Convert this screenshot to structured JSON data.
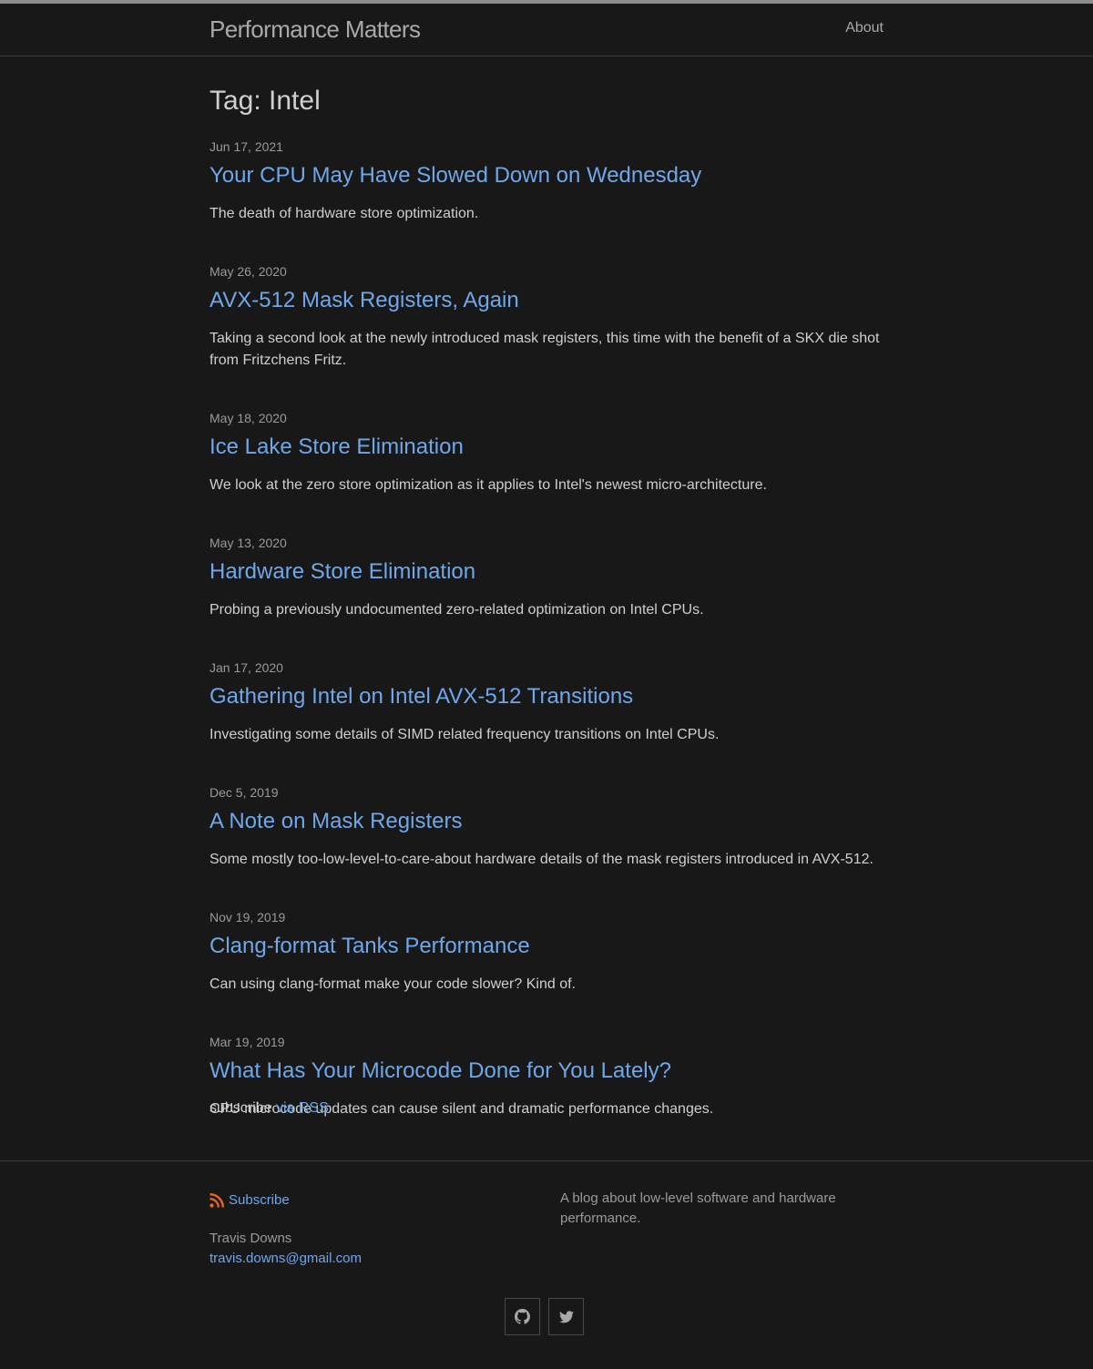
{
  "header": {
    "site_title": "Performance Matters",
    "nav": [
      {
        "label": "About"
      }
    ]
  },
  "page": {
    "heading": "Tag: Intel"
  },
  "posts": [
    {
      "date": "Jun 17, 2021",
      "title": "Your CPU May Have Slowed Down on Wednesday",
      "excerpt": "The death of hardware store optimization."
    },
    {
      "date": "May 26, 2020",
      "title": "AVX-512 Mask Registers, Again",
      "excerpt": "Taking a second look at the newly introduced mask registers, this time with the benefit of a SKX die shot from Fritzchens Fritz."
    },
    {
      "date": "May 18, 2020",
      "title": "Ice Lake Store Elimination",
      "excerpt": "We look at the zero store optimization as it applies to Intel's newest micro-architecture."
    },
    {
      "date": "May 13, 2020",
      "title": "Hardware Store Elimination",
      "excerpt": "Probing a previously undocumented zero-related optimization on Intel CPUs."
    },
    {
      "date": "Jan 17, 2020",
      "title": "Gathering Intel on Intel AVX-512 Transitions",
      "excerpt": "Investigating some details of SIMD related frequency transitions on Intel CPUs."
    },
    {
      "date": "Dec 5, 2019",
      "title": "A Note on Mask Registers",
      "excerpt": "Some mostly too-low-level-to-care-about hardware details of the mask registers introduced in AVX-512."
    },
    {
      "date": "Nov 19, 2019",
      "title": "Clang-format Tanks Performance",
      "excerpt": "Can using clang-format make your code slower? Kind of."
    },
    {
      "date": "Mar 19, 2019",
      "title": "What Has Your Microcode Done for You Lately?",
      "excerpt": "CPU microcode updates can cause silent and dramatic performance changes."
    }
  ],
  "rss_line": {
    "prefix": "subscribe",
    "link": "via RSS"
  },
  "footer": {
    "subscribe_label": "Subscribe",
    "author_name": "Travis Downs",
    "author_email": "travis.downs@gmail.com",
    "description": "A blog about low-level software and hardware performance.",
    "social": [
      {
        "icon": "github-icon"
      },
      {
        "icon": "twitter-icon"
      }
    ]
  },
  "colors": {
    "background": "#181818",
    "link": "#6fa8ea",
    "text": "#cfcfcf",
    "muted": "#9a9a9a",
    "rss": "#e8661f"
  }
}
